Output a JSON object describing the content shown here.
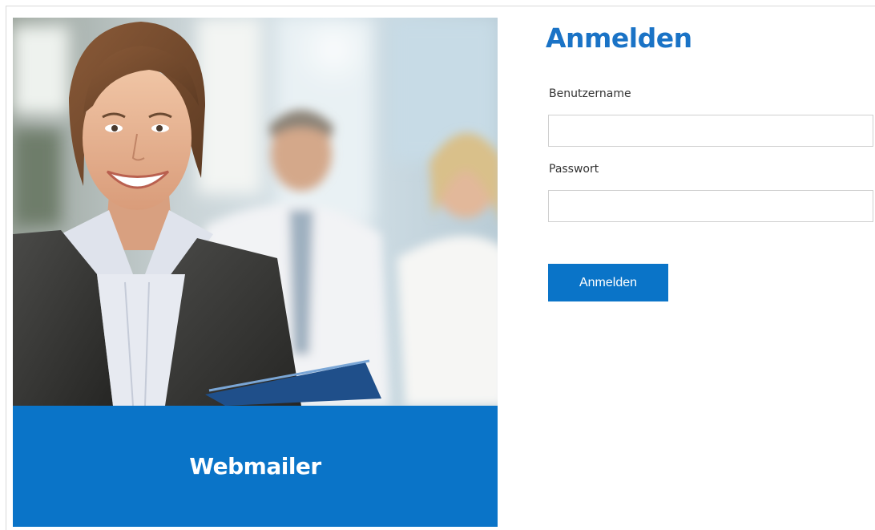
{
  "hero": {
    "image_description": "",
    "banner_title": "Webmailer",
    "banner_color": "#0a74c8"
  },
  "login": {
    "title": "Anmelden",
    "title_color": "#1a73c6",
    "username": {
      "label": "Benutzername",
      "value": "",
      "placeholder": ""
    },
    "password": {
      "label": "Passwort",
      "value": "",
      "placeholder": ""
    },
    "submit_label": "Anmelden",
    "button_color": "#0a74c8"
  }
}
